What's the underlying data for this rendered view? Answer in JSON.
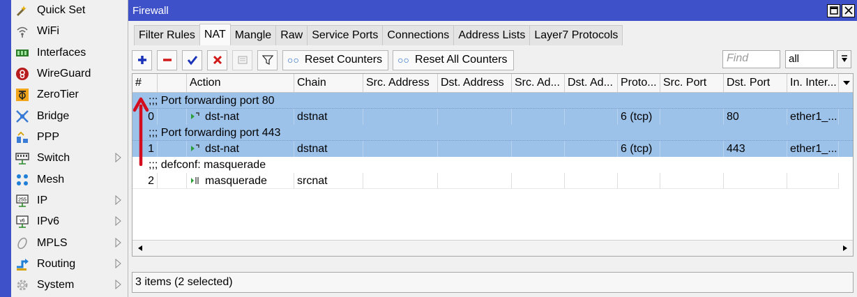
{
  "sidebar": {
    "items": [
      {
        "label": "Quick Set",
        "icon": "quick-set-icon",
        "submenu": false
      },
      {
        "label": "WiFi",
        "icon": "wifi-icon",
        "submenu": false
      },
      {
        "label": "Interfaces",
        "icon": "interfaces-icon",
        "submenu": false
      },
      {
        "label": "WireGuard",
        "icon": "wireguard-icon",
        "submenu": false
      },
      {
        "label": "ZeroTier",
        "icon": "zerotier-icon",
        "submenu": false
      },
      {
        "label": "Bridge",
        "icon": "bridge-icon",
        "submenu": false
      },
      {
        "label": "PPP",
        "icon": "ppp-icon",
        "submenu": false
      },
      {
        "label": "Switch",
        "icon": "switch-icon",
        "submenu": true
      },
      {
        "label": "Mesh",
        "icon": "mesh-icon",
        "submenu": false
      },
      {
        "label": "IP",
        "icon": "ip-icon",
        "submenu": true
      },
      {
        "label": "IPv6",
        "icon": "ipv6-icon",
        "submenu": true
      },
      {
        "label": "MPLS",
        "icon": "mpls-icon",
        "submenu": true
      },
      {
        "label": "Routing",
        "icon": "routing-icon",
        "submenu": true
      },
      {
        "label": "System",
        "icon": "system-icon",
        "submenu": true
      }
    ]
  },
  "window": {
    "title": "Firewall",
    "tabs": [
      {
        "label": "Filter Rules",
        "active": false
      },
      {
        "label": "NAT",
        "active": true
      },
      {
        "label": "Mangle",
        "active": false
      },
      {
        "label": "Raw",
        "active": false
      },
      {
        "label": "Service Ports",
        "active": false
      },
      {
        "label": "Connections",
        "active": false
      },
      {
        "label": "Address Lists",
        "active": false
      },
      {
        "label": "Layer7 Protocols",
        "active": false
      }
    ]
  },
  "toolbar": {
    "reset_counters": "Reset Counters",
    "reset_all_counters": "Reset All Counters",
    "find_placeholder": "Find",
    "filter_value": "all"
  },
  "table": {
    "columns": [
      "#",
      "",
      "Action",
      "Chain",
      "Src. Address",
      "Dst. Address",
      "Src. Ad...",
      "Dst. Ad...",
      "Proto...",
      "Src. Port",
      "Dst. Port",
      "In. Inter..."
    ],
    "rows": [
      {
        "kind": "comment",
        "text": ";;; Port forwarding port 80",
        "selected": true
      },
      {
        "kind": "rule",
        "num": "0",
        "action": "dst-nat",
        "chain": "dstnat",
        "protocol": "6 (tcp)",
        "dst_port": "80",
        "in_interface": "ether1_...",
        "selected": true
      },
      {
        "kind": "comment",
        "text": ";;; Port forwarding port 443",
        "selected": true
      },
      {
        "kind": "rule",
        "num": "1",
        "action": "dst-nat",
        "chain": "dstnat",
        "protocol": "6 (tcp)",
        "dst_port": "443",
        "in_interface": "ether1_...",
        "selected": true
      },
      {
        "kind": "comment",
        "text": ";;; defconf: masquerade",
        "selected": false
      },
      {
        "kind": "rule",
        "num": "2",
        "action": "masquerade",
        "chain": "srcnat",
        "protocol": "",
        "dst_port": "",
        "in_interface": "",
        "selected": false
      }
    ]
  },
  "status": {
    "text": "3 items (2 selected)"
  },
  "colors": {
    "titlebar": "#3f51c8",
    "selection": "#9cc2ea",
    "annotation_arrow": "#d40d1e"
  }
}
